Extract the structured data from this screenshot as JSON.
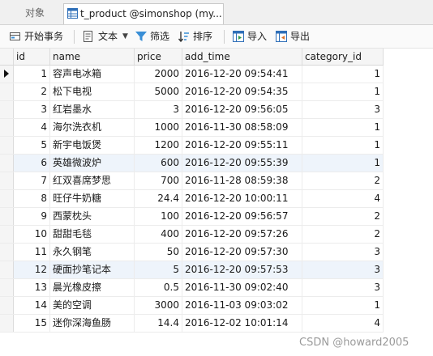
{
  "tabs": {
    "objects_label": "对象",
    "table_label": "t_product @simonshop (my..."
  },
  "toolbar": {
    "begin_transaction": "开始事务",
    "text": "文本",
    "filter": "筛选",
    "sort": "排序",
    "import": "导入",
    "export": "导出"
  },
  "grid": {
    "columns": [
      "id",
      "name",
      "price",
      "add_time",
      "category_id"
    ],
    "rows": [
      {
        "id": "1",
        "name": "容声电冰箱",
        "price": "2000",
        "add_time": "2016-12-20 09:54:41",
        "category_id": "1"
      },
      {
        "id": "2",
        "name": "松下电视",
        "price": "5000",
        "add_time": "2016-12-20 09:54:35",
        "category_id": "1"
      },
      {
        "id": "3",
        "name": "红岩墨水",
        "price": "3",
        "add_time": "2016-12-20 09:56:05",
        "category_id": "3"
      },
      {
        "id": "4",
        "name": "海尔洗衣机",
        "price": "1000",
        "add_time": "2016-11-30 08:58:09",
        "category_id": "1"
      },
      {
        "id": "5",
        "name": "新宇电饭煲",
        "price": "1200",
        "add_time": "2016-12-20 09:55:11",
        "category_id": "1"
      },
      {
        "id": "6",
        "name": "英雄微波炉",
        "price": "600",
        "add_time": "2016-12-20 09:55:39",
        "category_id": "1"
      },
      {
        "id": "7",
        "name": "红双喜席梦思",
        "price": "700",
        "add_time": "2016-11-28 08:59:38",
        "category_id": "2"
      },
      {
        "id": "8",
        "name": "旺仔牛奶糖",
        "price": "24.4",
        "add_time": "2016-12-20 10:00:11",
        "category_id": "4"
      },
      {
        "id": "9",
        "name": "西蒙枕头",
        "price": "100",
        "add_time": "2016-12-20 09:56:57",
        "category_id": "2"
      },
      {
        "id": "10",
        "name": "甜甜毛毯",
        "price": "400",
        "add_time": "2016-12-20 09:57:26",
        "category_id": "2"
      },
      {
        "id": "11",
        "name": "永久钢笔",
        "price": "50",
        "add_time": "2016-12-20 09:57:30",
        "category_id": "3"
      },
      {
        "id": "12",
        "name": "硬面抄笔记本",
        "price": "5",
        "add_time": "2016-12-20 09:57:53",
        "category_id": "3"
      },
      {
        "id": "13",
        "name": "晨光橡皮擦",
        "price": "0.5",
        "add_time": "2016-11-30 09:02:40",
        "category_id": "3"
      },
      {
        "id": "14",
        "name": "美的空调",
        "price": "3000",
        "add_time": "2016-11-03 09:03:02",
        "category_id": "1"
      },
      {
        "id": "15",
        "name": "迷你深海鱼肠",
        "price": "14.4",
        "add_time": "2016-12-02 10:01:14",
        "category_id": "4"
      }
    ]
  },
  "watermark": "CSDN @howard2005",
  "icons": {
    "table_tab": "table-grid-icon",
    "begin_transaction": "transaction-icon",
    "text": "text-lines-icon",
    "filter": "funnel-icon",
    "sort": "sort-icon",
    "import": "import-table-icon",
    "export": "export-table-icon",
    "row_pointer": "row-pointer-icon"
  },
  "colors": {
    "selected_row": "#eef4fb",
    "filter_icon": "#3a8fd6",
    "table_icon": "#2f6fb8"
  }
}
